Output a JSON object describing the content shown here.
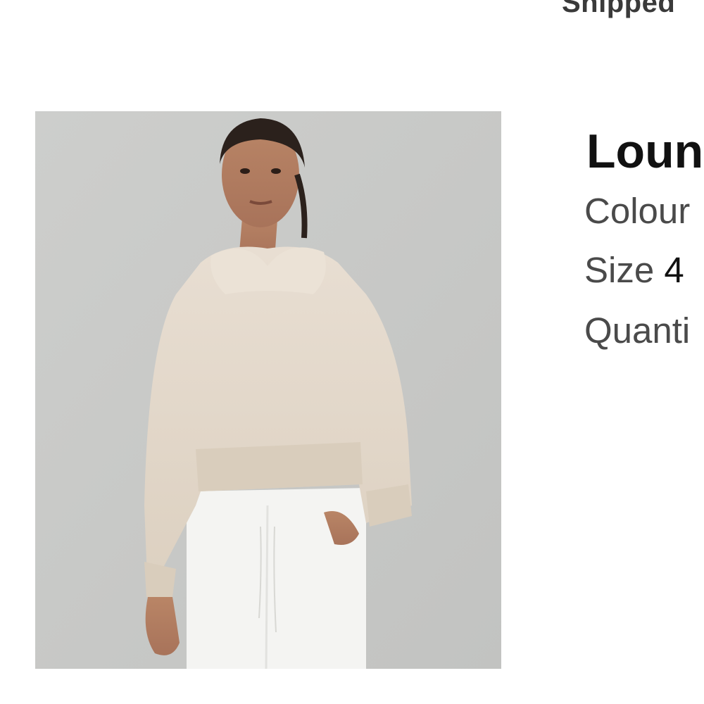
{
  "order": {
    "status_text": "Shipped"
  },
  "product": {
    "name": "Loung",
    "image_alt": "Model wearing a cropped cream hoodie and white joggers",
    "colour_label": "Colour",
    "size_label": "Size",
    "size_value": "4",
    "quantity_label": "Quanti"
  },
  "colors": {
    "image_background": "#c8c9c7",
    "hoodie": "#e3d8ca",
    "pants": "#f4f4f2",
    "label_text": "#4a4a4a",
    "value_text": "#111111"
  }
}
